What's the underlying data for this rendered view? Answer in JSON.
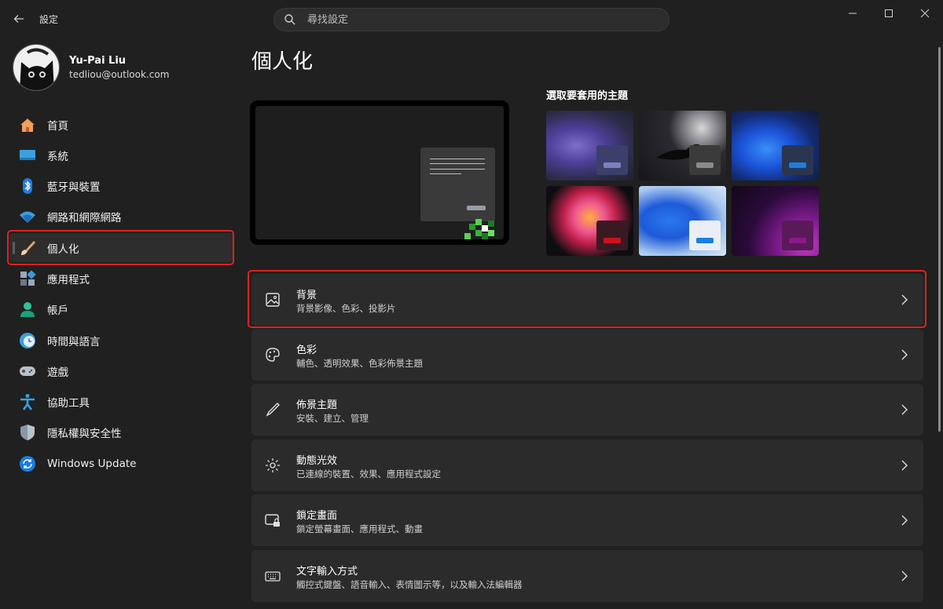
{
  "window": {
    "title": "設定"
  },
  "search": {
    "placeholder": "尋找設定"
  },
  "user": {
    "name": "Yu-Pai Liu",
    "email": "tedliou@outlook.com"
  },
  "sidebar": {
    "items": [
      {
        "label": "首頁",
        "icon": "home-icon"
      },
      {
        "label": "系統",
        "icon": "system-icon"
      },
      {
        "label": "藍牙與裝置",
        "icon": "bluetooth-icon"
      },
      {
        "label": "網路和網際網路",
        "icon": "wifi-icon"
      },
      {
        "label": "個人化",
        "icon": "brush-icon",
        "active": true
      },
      {
        "label": "應用程式",
        "icon": "apps-icon"
      },
      {
        "label": "帳戶",
        "icon": "account-icon"
      },
      {
        "label": "時間與語言",
        "icon": "time-language-icon"
      },
      {
        "label": "遊戲",
        "icon": "gaming-icon"
      },
      {
        "label": "協助工具",
        "icon": "accessibility-icon"
      },
      {
        "label": "隱私權與安全性",
        "icon": "shield-icon"
      },
      {
        "label": "Windows Update",
        "icon": "update-icon"
      }
    ]
  },
  "main": {
    "title": "個人化",
    "themes_heading": "選取要套用的主題",
    "themes": [
      {
        "name": "theme-purple-bloom",
        "chip": "#3c3f6a",
        "accent": "#7c80c0"
      },
      {
        "name": "theme-crow-moon",
        "chip": "#3b3b3b",
        "accent": "#8a8a8a"
      },
      {
        "name": "theme-blue-bloom-dark",
        "chip": "#2a3550",
        "accent": "#1a7fe0"
      },
      {
        "name": "theme-flower",
        "chip": "#3a1a22",
        "accent": "#d01020"
      },
      {
        "name": "theme-blue-bloom-light",
        "chip": "#eaeef5",
        "accent": "#1a7fe0"
      },
      {
        "name": "theme-glow",
        "chip": "#5a1a5a",
        "accent": "#8a1a8a"
      }
    ],
    "cards": [
      {
        "title": "背景",
        "subtitle": "背景影像、色彩、投影片",
        "icon": "picture-icon"
      },
      {
        "title": "色彩",
        "subtitle": "輔色、透明效果、色彩佈景主題",
        "icon": "palette-icon"
      },
      {
        "title": "佈景主題",
        "subtitle": "安裝、建立、管理",
        "icon": "pen-icon"
      },
      {
        "title": "動態光效",
        "subtitle": "已連線的裝置、效果、應用程式設定",
        "icon": "lighting-icon"
      },
      {
        "title": "鎖定畫面",
        "subtitle": "鎖定螢幕畫面、應用程式、動畫",
        "icon": "lock-screen-icon"
      },
      {
        "title": "文字輸入方式",
        "subtitle": "觸控式鍵盤、語音輸入、表情圖示等，以及輸入法編輯器",
        "icon": "keyboard-icon"
      }
    ]
  },
  "colors": {
    "highlight": "#e02020",
    "background": "#202020",
    "card": "#2b2b2b"
  }
}
